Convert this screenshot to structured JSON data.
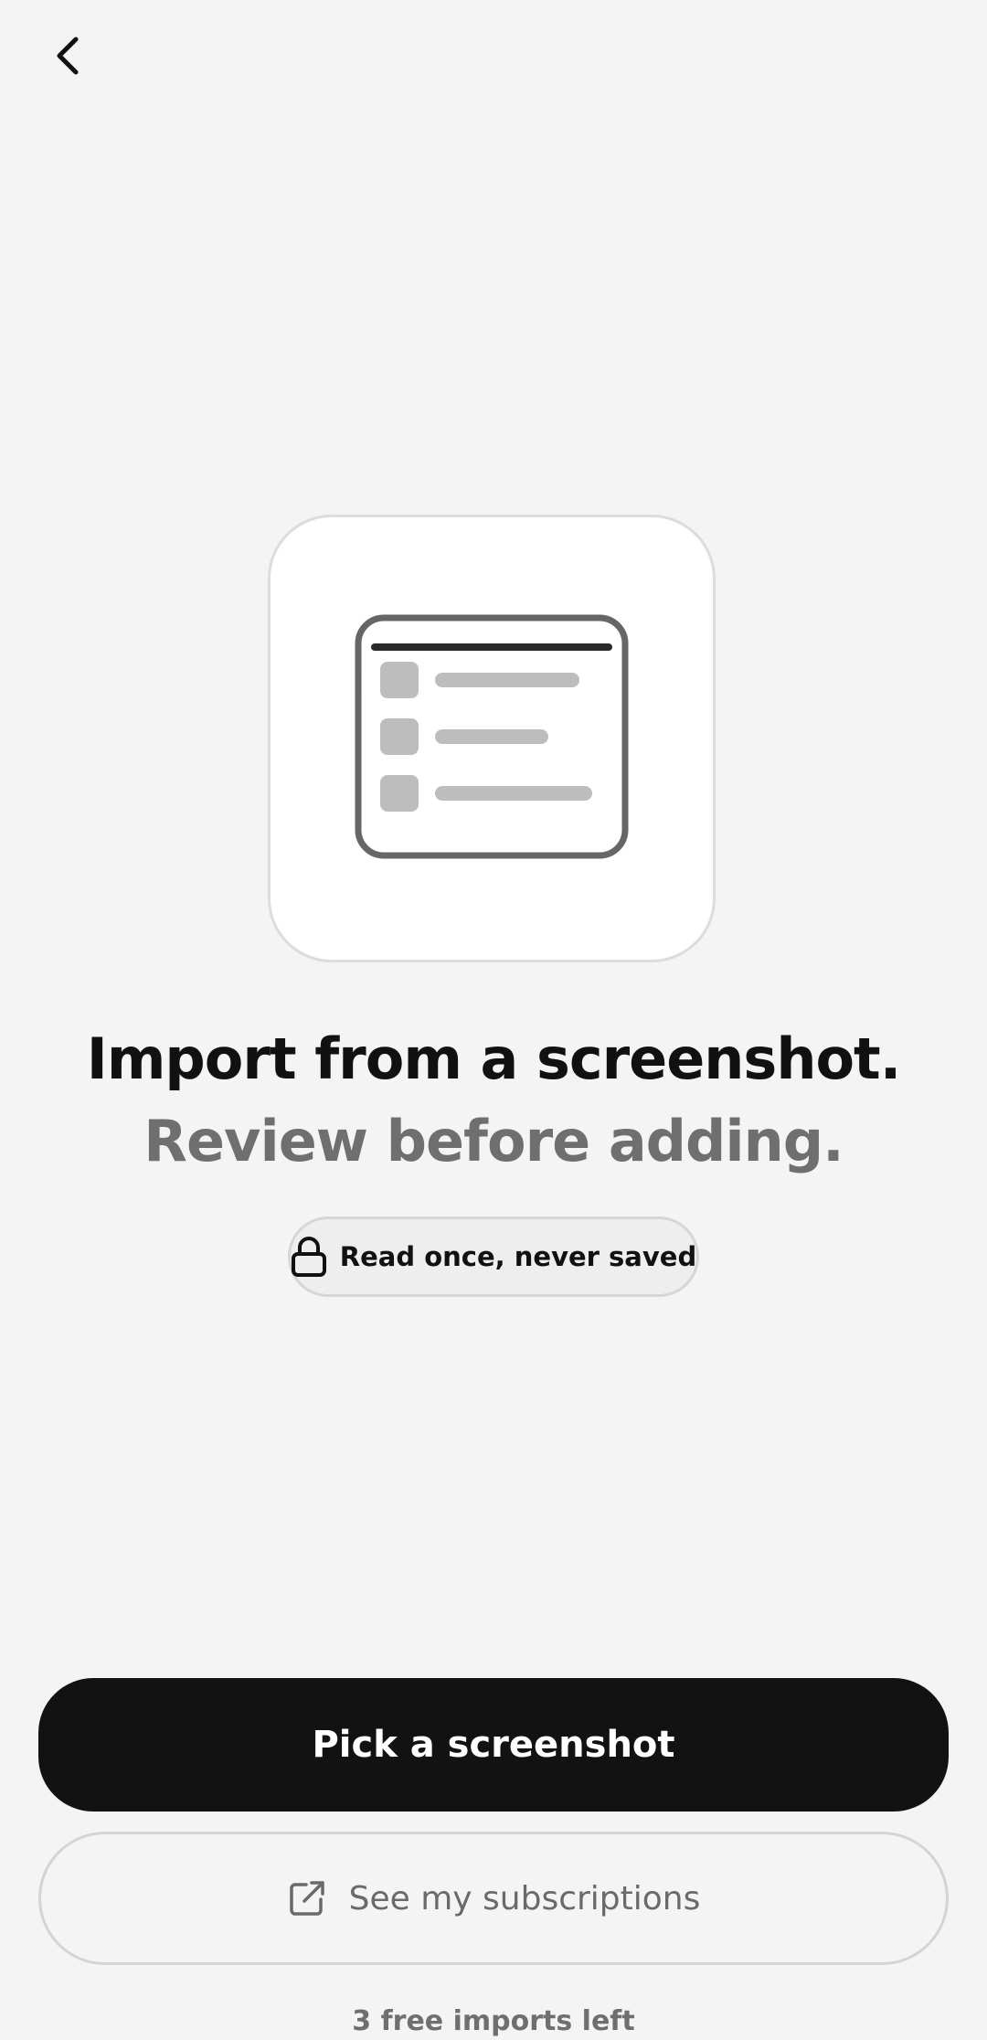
{
  "nav": {
    "back_icon": "chevron-left-icon"
  },
  "illustration": {
    "icon": "document-list-icon"
  },
  "headline": {
    "primary": "Import from a screenshot.",
    "secondary": "Review before adding."
  },
  "privacy_badge": {
    "icon": "lock-icon",
    "label": "Read once, never saved"
  },
  "actions": {
    "primary_label": "Pick a screenshot",
    "secondary_label": "See my subscriptions",
    "secondary_icon": "external-link-icon"
  },
  "footer": {
    "free_imports": "3 free imports left"
  },
  "colors": {
    "background": "#f4f4f4",
    "primary_button": "#121212",
    "muted_text": "#6f6f6f"
  }
}
